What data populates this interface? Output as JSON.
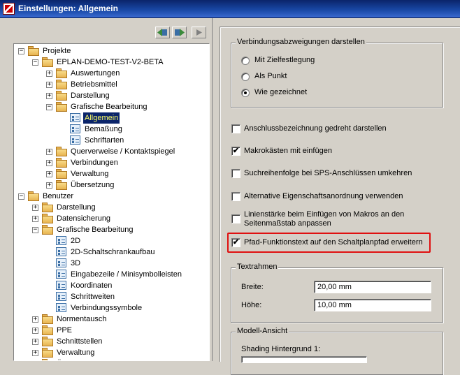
{
  "window": {
    "title": "Einstellungen: Allgemein"
  },
  "toolbar": {
    "back_label": "◄",
    "forward_label": "►",
    "play_label": "▶"
  },
  "tree": {
    "items": [
      {
        "label": "Projekte",
        "icon": "folder-icon",
        "expander": "−"
      },
      {
        "label": "EPLAN-DEMO-TEST-V2-BETA",
        "icon": "folder-icon",
        "expander": "−"
      },
      {
        "label": "Auswertungen",
        "icon": "folder-icon",
        "expander": "+"
      },
      {
        "label": "Betriebsmittel",
        "icon": "folder-icon",
        "expander": "+"
      },
      {
        "label": "Darstellung",
        "icon": "folder-icon",
        "expander": "+"
      },
      {
        "label": "Grafische Bearbeitung",
        "icon": "folder-icon",
        "expander": "−"
      },
      {
        "label": "Allgemein",
        "icon": "document-icon",
        "expander": ""
      },
      {
        "label": "Bemaßung",
        "icon": "document-icon",
        "expander": ""
      },
      {
        "label": "Schriftarten",
        "icon": "document-icon",
        "expander": ""
      },
      {
        "label": "Querverweise / Kontaktspiegel",
        "icon": "folder-icon",
        "expander": "+"
      },
      {
        "label": "Verbindungen",
        "icon": "folder-icon",
        "expander": "+"
      },
      {
        "label": "Verwaltung",
        "icon": "folder-icon",
        "expander": "+"
      },
      {
        "label": "Übersetzung",
        "icon": "folder-icon",
        "expander": "+"
      },
      {
        "label": "Benutzer",
        "icon": "folder-icon",
        "expander": "−"
      },
      {
        "label": "Darstellung",
        "icon": "folder-icon",
        "expander": "+"
      },
      {
        "label": "Datensicherung",
        "icon": "folder-icon",
        "expander": "+"
      },
      {
        "label": "Grafische Bearbeitung",
        "icon": "folder-icon",
        "expander": "−"
      },
      {
        "label": "2D",
        "icon": "document-icon",
        "expander": ""
      },
      {
        "label": "2D-Schaltschrankaufbau",
        "icon": "document-icon",
        "expander": ""
      },
      {
        "label": "3D",
        "icon": "document-icon",
        "expander": ""
      },
      {
        "label": "Eingabezeile / Minisymbolleisten",
        "icon": "document-icon",
        "expander": ""
      },
      {
        "label": "Koordinaten",
        "icon": "document-icon",
        "expander": ""
      },
      {
        "label": "Schrittweiten",
        "icon": "document-icon",
        "expander": ""
      },
      {
        "label": "Verbindungssymbole",
        "icon": "document-icon",
        "expander": ""
      },
      {
        "label": "Normentausch",
        "icon": "folder-icon",
        "expander": "+"
      },
      {
        "label": "PPE",
        "icon": "folder-icon",
        "expander": "+"
      },
      {
        "label": "Schnittstellen",
        "icon": "folder-icon",
        "expander": "+"
      },
      {
        "label": "Verwaltung",
        "icon": "folder-icon",
        "expander": "+"
      },
      {
        "label": "Übersetzung",
        "icon": "folder-icon",
        "expander": "+"
      }
    ],
    "selected_index": 6
  },
  "connections": {
    "legend": "Verbindungsabzweigungen darstellen",
    "options": [
      {
        "label": "Mit Zielfestlegung",
        "checked": false
      },
      {
        "label": "Als Punkt",
        "checked": false
      },
      {
        "label": "Wie gezeichnet",
        "checked": true
      }
    ]
  },
  "checkboxes": [
    {
      "label": "Anschlussbezeichnung gedreht darstellen",
      "checked": false
    },
    {
      "label": "Makrokästen mit einfügen",
      "checked": true
    },
    {
      "label": "Suchreihenfolge bei SPS-Anschlüssen umkehren",
      "checked": false
    },
    {
      "label": "Alternative Eigenschaftsanordnung verwenden",
      "checked": false
    },
    {
      "label": "Linienstärke beim Einfügen von Makros an den",
      "label2": "Seitenmaßstab anpassen",
      "checked": false
    },
    {
      "label": "Pfad-Funktionstext auf den Schaltplanpfad erweitern",
      "checked": true
    }
  ],
  "check_mark": "✔",
  "textframe": {
    "legend": "Textrahmen",
    "width_label": "Breite:",
    "width_value": "20,00 mm",
    "height_label": "Höhe:",
    "height_value": "10,00 mm"
  },
  "model_view": {
    "legend": "Modell-Ansicht",
    "shading_label": "Shading Hintergrund 1:"
  },
  "colors": {
    "highlight": "#e01010",
    "selection": "#0a246a",
    "selection_text": "#ffff66"
  }
}
